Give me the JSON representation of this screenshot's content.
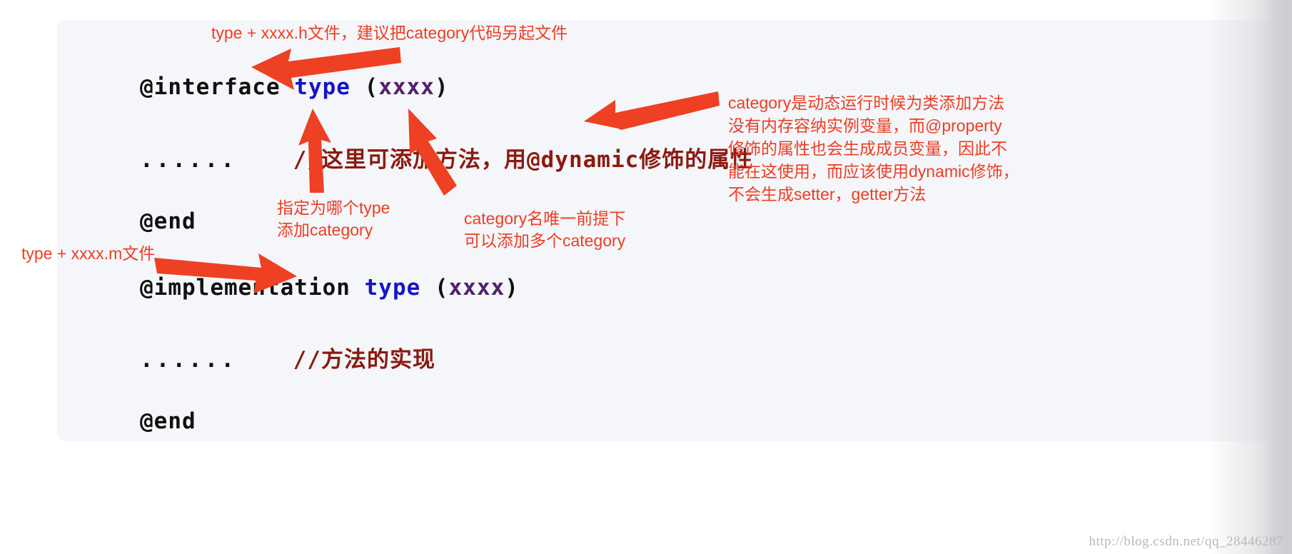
{
  "panel": {
    "background_color": "#f4f6f9",
    "page_background": "#ffffff"
  },
  "colors": {
    "annotation_red": "#ee3d23",
    "arrow_red": "#ee4023",
    "keyword_black": "#111111",
    "type_blue": "#1414c8",
    "category_purple": "#54216b",
    "comment_darkred": "#8b1a10",
    "watermark_gray": "#b9b9b9"
  },
  "code": {
    "interface_line": {
      "keyword": "@interface",
      "space1": " ",
      "type": "type",
      "space2": " ",
      "paren_open": "(",
      "category": "xxxx",
      "paren_close": ")"
    },
    "body_line_1": {
      "dots": "......",
      "gap": "    ",
      "comment": "//这里可添加方法，用@dynamic修饰的属性"
    },
    "end_line_1": "@end",
    "implementation_line": {
      "keyword": "@implementation",
      "space1": " ",
      "type": "type",
      "space2": " ",
      "paren_open": "(",
      "category": "xxxx",
      "paren_close": ")"
    },
    "body_line_2": {
      "dots": "......",
      "gap": "    ",
      "comment": "//方法的实现"
    },
    "end_line_2": "@end"
  },
  "annotations": {
    "header_h_file": "type + xxxx.h文件，建议把category代码另起文件",
    "m_file": "type + xxxx.m文件",
    "which_type": {
      "line1": "指定为哪个type",
      "line2": "添加category"
    },
    "unique_name": {
      "line1": "category名唯一前提下",
      "line2": "可以添加多个category"
    },
    "right_block": {
      "line1": "category是动态运行时候为类添加方法",
      "line2": "没有内存容纳实例变量，而@property",
      "line3": "修饰的属性也会生成成员变量，因此不",
      "line4": "能在这使用，而应该使用dynamic修饰，",
      "line5": "不会生成setter，getter方法"
    }
  },
  "arrows": [
    {
      "name": "arrow-to-interface-keyword",
      "direction": "left"
    },
    {
      "name": "arrow-to-type-token",
      "direction": "up"
    },
    {
      "name": "arrow-to-category-token",
      "direction": "up-left"
    },
    {
      "name": "arrow-to-right-note",
      "direction": "left"
    },
    {
      "name": "arrow-to-implementation-keyword",
      "direction": "right"
    }
  ],
  "watermark": "http://blog.csdn.net/qq_28446287"
}
